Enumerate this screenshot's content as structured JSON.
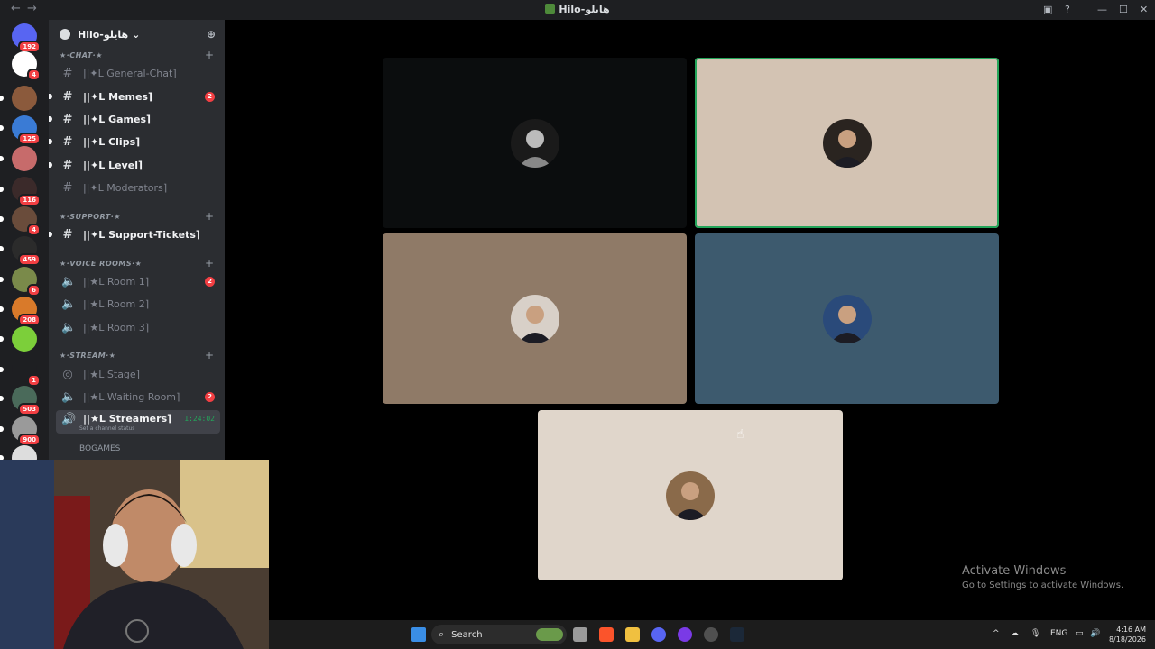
{
  "window": {
    "title": "Hilo-هايلو",
    "back_icon": "←",
    "forward_icon": "→"
  },
  "rail": {
    "servers": [
      {
        "name": "home",
        "badge": "192",
        "color": "#5865f2"
      },
      {
        "name": "server-mustache",
        "badge": "4",
        "color": "#ffffff"
      },
      {
        "name": "server-2",
        "badge": "",
        "color": "#8b5a3c"
      },
      {
        "name": "server-3",
        "badge": "125",
        "color": "#3a7bd5"
      },
      {
        "name": "server-4",
        "badge": "",
        "color": "#c76b6b"
      },
      {
        "name": "server-5",
        "badge": "116",
        "color": "#3b2a2a"
      },
      {
        "name": "server-6",
        "badge": "4",
        "color": "#6a4c3b"
      },
      {
        "name": "server-7",
        "badge": "459",
        "color": "#2b2b2b"
      },
      {
        "name": "server-8",
        "badge": "6",
        "color": "#7a8a4a"
      },
      {
        "name": "server-9",
        "badge": "208",
        "color": "#d97a2a"
      },
      {
        "name": "server-10",
        "badge": "",
        "color": "#7ccf3a"
      },
      {
        "name": "server-11",
        "badge": "1",
        "color": "#1e1f22"
      },
      {
        "name": "server-12",
        "badge": "503",
        "color": "#4a6a5a"
      },
      {
        "name": "server-13",
        "badge": "900",
        "color": "#9a9a9a"
      },
      {
        "name": "server-14",
        "badge": "",
        "color": "#dddddd"
      }
    ]
  },
  "guild": {
    "name": "Hilo-هايلو",
    "chevron": "⌄"
  },
  "categories": {
    "chat": "★·CHAT·★",
    "support": "★·SUPPORT·★",
    "voice": "★·VOICE ROOMS·★",
    "stream": "★·STREAM·★"
  },
  "channels": {
    "general_chat": "||✦L General-Chat⌉",
    "memes": "||✦L Memes⌉",
    "memes_mentions": "2",
    "games": "||✦L Games⌉",
    "clips": "||✦L Clips⌉",
    "level": "||✦L Level⌉",
    "moderators": "||✦L Moderators⌉",
    "support_tickets": "||✦L Support-Tickets⌉",
    "room1": "||★L Room 1⌉",
    "room1_mentions": "2",
    "room2": "||★L Room 2⌉",
    "room3": "||★L Room 3⌉",
    "stage": "||★L Stage⌉",
    "waiting_room": "||★L Waiting Room⌉",
    "waiting_room_mentions": "2",
    "streamers": "||★L Streamers⌉",
    "streamers_timer": "1:24:02",
    "streamers_status": "Set a channel status",
    "voice_user": "BOGAMES"
  },
  "tiles": [
    {
      "name": "participant-1",
      "bg": "#0b0d0e",
      "speaking": false
    },
    {
      "name": "participant-2",
      "bg": "#d3c3b3",
      "speaking": true
    },
    {
      "name": "participant-3",
      "bg": "#8f7a67",
      "speaking": false
    },
    {
      "name": "participant-4",
      "bg": "#3d5a6e",
      "speaking": false
    },
    {
      "name": "participant-5",
      "bg": "#e0d6cb",
      "speaking": false
    }
  ],
  "watermark": {
    "line1": "Activate Windows",
    "line2": "Go to Settings to activate Windows."
  },
  "taskbar": {
    "search_label": "Search",
    "language": "ENG",
    "time": "4:16 AM",
    "date": "8/18/2026"
  },
  "colors": {
    "speaking": "#23a55a",
    "mention": "#f23f43",
    "sidebar": "#2b2d31",
    "rail": "#1e1f22"
  }
}
